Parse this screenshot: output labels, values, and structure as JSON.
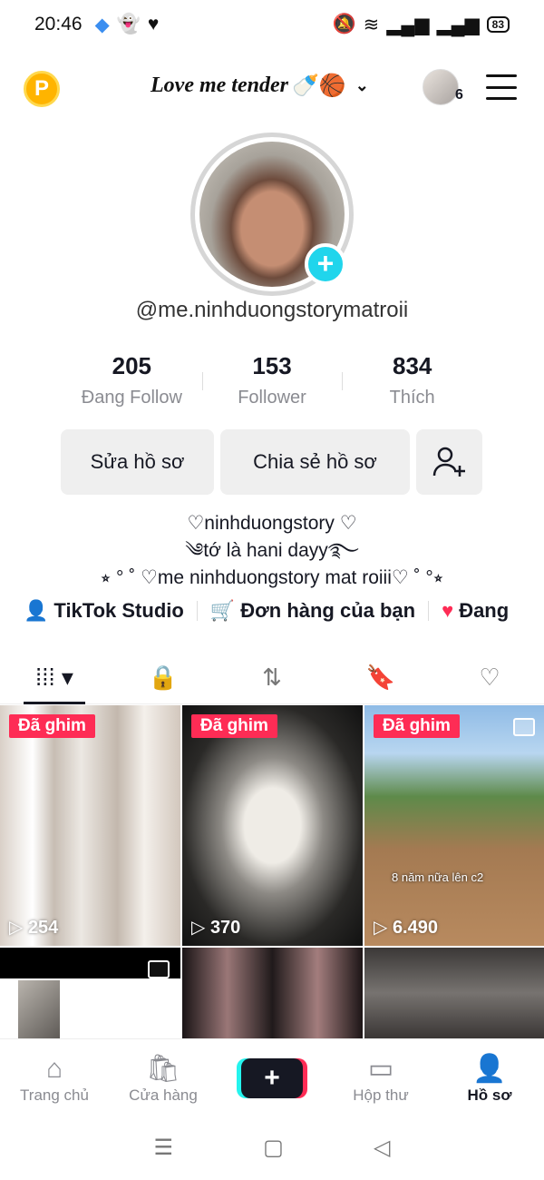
{
  "status_bar": {
    "time": "20:46",
    "battery": "83"
  },
  "header": {
    "account_name": "Love me tender",
    "account_emojis": "🍼🏀",
    "coin_label": "P",
    "notification_count": "6"
  },
  "profile": {
    "handle": "@me.ninhduongstorymatroii",
    "stats": [
      {
        "value": "205",
        "label": "Đang Follow"
      },
      {
        "value": "153",
        "label": "Follower"
      },
      {
        "value": "834",
        "label": "Thích"
      }
    ],
    "edit_button": "Sửa hồ sơ",
    "share_button": "Chia sẻ hồ sơ",
    "bio_lines": [
      "♡ninhduongstory ♡",
      "༄tớ là hani dayy࿐",
      "⭒ ° ˚ ♡me ninhduongstory mat roiii♡ ˚ °⭒"
    ]
  },
  "links": [
    {
      "label": "TikTok Studio"
    },
    {
      "label": "Đơn hàng của bạn"
    },
    {
      "label": "Đang"
    }
  ],
  "tabs": [
    "videos",
    "private",
    "reposts",
    "favorites",
    "liked"
  ],
  "videos": [
    {
      "pinned": "Đã ghim",
      "views": "254"
    },
    {
      "pinned": "Đã ghim",
      "views": "370"
    },
    {
      "pinned": "Đã ghim",
      "views": "6.490",
      "caption": "8 năm nữa lên c2"
    }
  ],
  "bottom_nav": [
    {
      "label": "Trang chủ"
    },
    {
      "label": "Cửa hàng"
    },
    {
      "label": "+"
    },
    {
      "label": "Hộp thư"
    },
    {
      "label": "Hồ sơ"
    }
  ]
}
